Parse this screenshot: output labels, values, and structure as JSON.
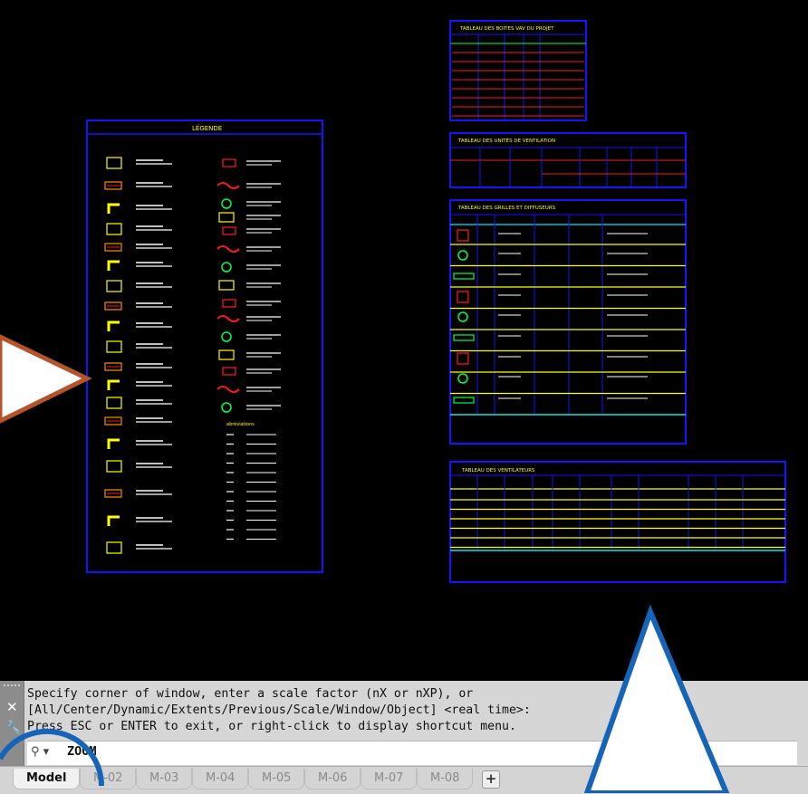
{
  "colors": {
    "frame": "#1414ff",
    "yellow": "#ffff00",
    "red": "#ff1a1a",
    "green": "#00ff40",
    "cyan": "#00e5ff",
    "orange": "#ff8c00",
    "white": "#ffffff"
  },
  "drawing": {
    "legend_title": "LÉGENDE",
    "legend_section_label": "abréviations",
    "table1_title": "TABLEAU DES BOITES VAV DU PROJET",
    "table2_title": "TABLEAU DES UNITÉS DE VENTILATION",
    "table3_title": "TABLEAU DES GRILLES ET DIFFUSEURS",
    "table4_title": "TABLEAU DES VENTILATEURS"
  },
  "command": {
    "history": [
      "Specify corner of window, enter a scale factor (nX or nXP), or",
      "[All/Center/Dynamic/Extents/Previous/Scale/Window/Object] <real time>:",
      "Press ESC or ENTER to exit, or right-click to display shortcut menu."
    ],
    "current": "ZOOM",
    "close_icon": "close-icon",
    "customize_icon": "wrench-icon",
    "recent_icon": "zoom-command-icon"
  },
  "tabs": {
    "items": [
      {
        "label": "Model",
        "active": true
      },
      {
        "label": "M-02",
        "active": false
      },
      {
        "label": "M-03",
        "active": false
      },
      {
        "label": "M-04",
        "active": false
      },
      {
        "label": "M-05",
        "active": false
      },
      {
        "label": "M-06",
        "active": false
      },
      {
        "label": "M-07",
        "active": false
      },
      {
        "label": "M-08",
        "active": false
      }
    ],
    "add_label": "+"
  }
}
